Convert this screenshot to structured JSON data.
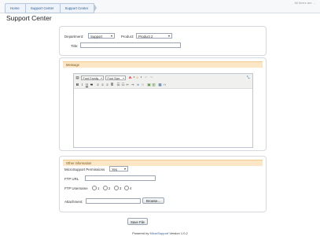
{
  "breadcrumb": [
    "Home",
    "Support Center",
    "Support Center"
  ],
  "top_right": "All times are ...",
  "page_title": "Support Center",
  "form": {
    "department_label": "Department:",
    "department_value": "Support",
    "product_label": "Product:",
    "product_value": "Product 2",
    "title_label": "Title:",
    "title_value": ""
  },
  "message": {
    "header": "Message",
    "font_family": "Font Family",
    "font_size": "Font Size",
    "content": ""
  },
  "other": {
    "header": "Other information",
    "permissions_label": "MicroSupport Permissions",
    "permissions_value": "Yes",
    "ftp_url_label": "FTP URL",
    "ftp_url_value": "",
    "ftp_user_label": "FTP Username",
    "ftp_options": [
      "1",
      "2",
      "3",
      "4"
    ],
    "attachment_label": "Attachment:",
    "browse_label": "Browse..."
  },
  "save_label": "Save File",
  "footer": {
    "prefix": "Powered by",
    "link": "MicroSupport",
    "suffix": "Version 1.0.2"
  }
}
